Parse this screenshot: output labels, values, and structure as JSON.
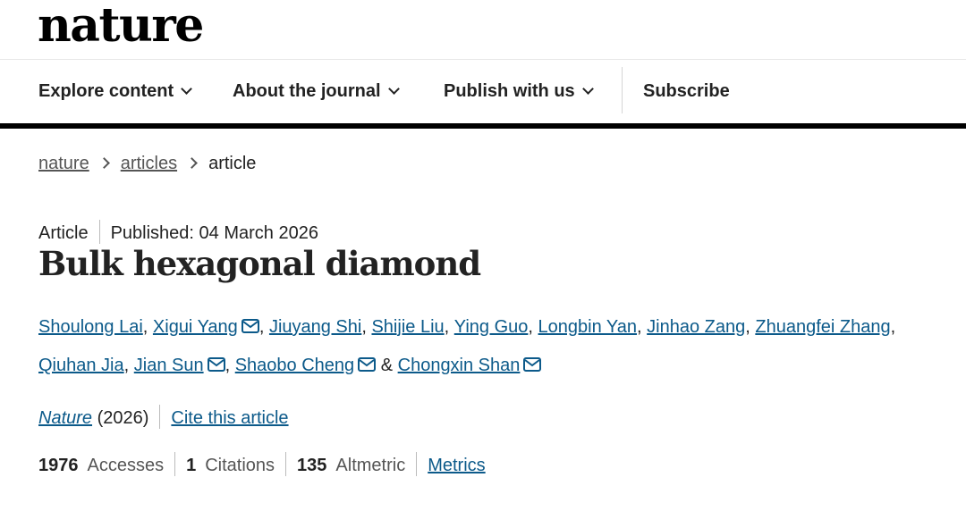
{
  "header": {
    "logo": "nature"
  },
  "nav": {
    "explore": "Explore content",
    "about": "About the journal",
    "publish": "Publish with us",
    "subscribe": "Subscribe"
  },
  "breadcrumb": {
    "home": "nature",
    "section": "articles",
    "current": "article"
  },
  "article": {
    "type": "Article",
    "published": "Published: 04 March 2026",
    "title": "Bulk hexagonal diamond",
    "authors": [
      {
        "name": "Shoulong Lai",
        "sep": ", "
      },
      {
        "name": "Xigui Yang",
        "sep": ", "
      },
      {
        "name": "Jiuyang Shi",
        "sep": ", "
      },
      {
        "name": "Shijie Liu",
        "sep": ", "
      },
      {
        "name": "Ying Guo",
        "sep": ", "
      },
      {
        "name": "Longbin Yan",
        "sep": ", "
      },
      {
        "name": "Jinhao Zang",
        "sep": ", "
      },
      {
        "name": "Zhuangfei Zhang",
        "sep": ", "
      },
      {
        "name": "Qiuhan Jia",
        "sep": ", "
      },
      {
        "name": "Jian Sun",
        "sep": ", "
      },
      {
        "name": "Shaobo Cheng",
        "sep": " & "
      },
      {
        "name": "Chongxin Shan",
        "sep": ""
      }
    ],
    "journal": "Nature",
    "year": "(2026)",
    "cite": "Cite this article"
  },
  "metrics": {
    "accesses_count": "1976",
    "accesses_label": "Accesses",
    "citations_count": "1",
    "citations_label": "Citations",
    "altmetric_count": "135",
    "altmetric_label": "Altmetric",
    "metrics_link": "Metrics"
  }
}
